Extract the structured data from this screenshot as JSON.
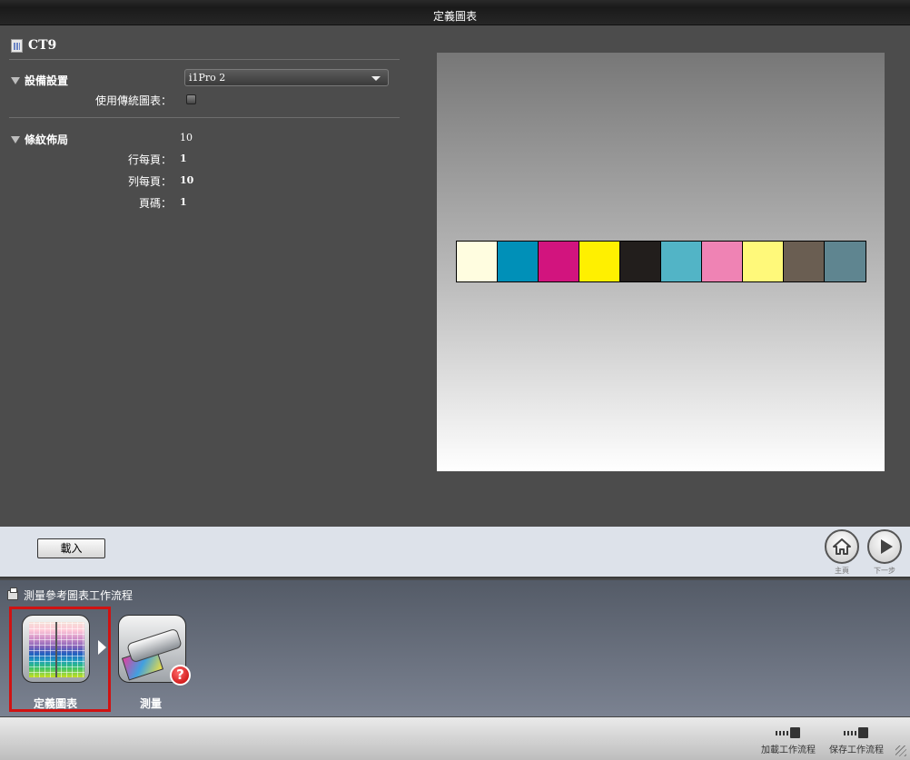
{
  "window": {
    "title": "定義圖表"
  },
  "chart": {
    "name": "CT9"
  },
  "device_section": {
    "label": "設備設置",
    "device_value": "i1Pro 2",
    "legacy_label": "使用傳統圖表："
  },
  "layout_section": {
    "label": "條紋佈局",
    "patch_count": "10",
    "rows_label": "行每頁：",
    "rows_value": "1",
    "cols_label": "列每頁：",
    "cols_value": "10",
    "page_label": "頁碼：",
    "page_value": "1"
  },
  "preview": {
    "patch_colors": [
      "#fffde0",
      "#0090b8",
      "#d2147e",
      "#fff000",
      "#221e1c",
      "#52b4c6",
      "#ef83b4",
      "#fff97a",
      "#6a5e52",
      "#5f8590"
    ]
  },
  "actions": {
    "load_label": "載入",
    "home_caption": "主頁",
    "next_caption": "下一步"
  },
  "workflow": {
    "title": "測量參考圖表工作流程",
    "steps": [
      {
        "label": "定義圖表"
      },
      {
        "label": "測量"
      }
    ],
    "error_mark": "?"
  },
  "footer": {
    "load_workflow_label": "加載工作流程",
    "save_workflow_label": "保存工作流程"
  }
}
